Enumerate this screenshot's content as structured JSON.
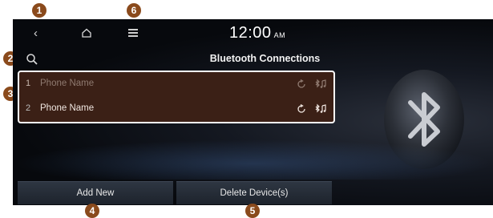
{
  "callouts": {
    "c1": "1",
    "c2": "2",
    "c3": "3",
    "c4": "4",
    "c5": "5",
    "c6": "6"
  },
  "topbar": {
    "time": "12:00",
    "ampm": "AM",
    "back_icon": "back-icon",
    "home_icon": "home-icon",
    "menu_icon": "menu-icon"
  },
  "header": {
    "title": "Bluetooth Connections",
    "search_icon": "search-icon"
  },
  "devices": [
    {
      "number": "1",
      "name": "Phone Name",
      "active": false
    },
    {
      "number": "2",
      "name": "Phone Name",
      "active": true
    }
  ],
  "buttons": {
    "add_new": "Add New",
    "delete_devices": "Delete Device(s)"
  },
  "colors": {
    "callout": "#8a4a1c",
    "list_bg": "#3b2016",
    "screen_bg": "#07090d"
  }
}
